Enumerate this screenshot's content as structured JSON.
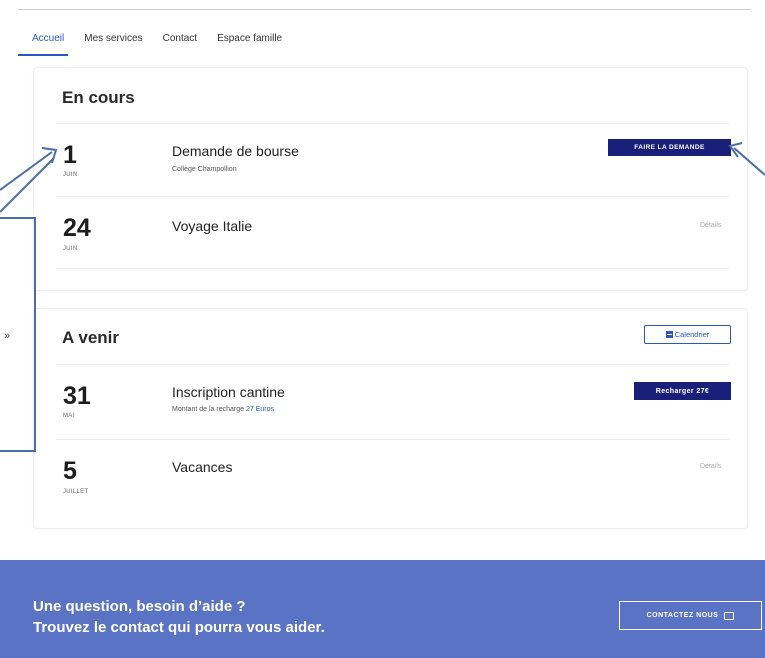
{
  "nav": {
    "tabs": [
      {
        "label": "Accueil",
        "active": true
      },
      {
        "label": "Mes services"
      },
      {
        "label": "Contact"
      },
      {
        "label": "Espace famille"
      }
    ]
  },
  "en_cours": {
    "title": "En cours",
    "items": [
      {
        "day": "1",
        "month": "JUIN",
        "title": "Demande de bourse",
        "subtitle": "Collège Champollion",
        "action": "FAIRE LA DEMANDE"
      },
      {
        "day": "24",
        "month": "JUIN",
        "title": "Voyage Italie",
        "action": "Détails"
      }
    ]
  },
  "a_venir": {
    "title": "A venir",
    "calendar_label": "Calendrier",
    "items": [
      {
        "day": "31",
        "month": "MAI",
        "title": "Inscription cantine",
        "subtitle_prefix": "Montant de la recharge",
        "subtitle_highlight": "27 Euros",
        "action": "Recharger 27€"
      },
      {
        "day": "5",
        "month": "JUILLET",
        "title": "Vacances",
        "action": "Détails"
      }
    ]
  },
  "footer": {
    "line1": "Une question, besoin d’aide ?",
    "line2": "Trouvez le contact qui pourra vous aider.",
    "button": "CONTACTEZ NOUS"
  },
  "annotation": {
    "fragment": "»"
  },
  "colors": {
    "primary": "#1a1f7a",
    "accent": "#2b57c7",
    "footer_bg": "#5a73c4"
  }
}
